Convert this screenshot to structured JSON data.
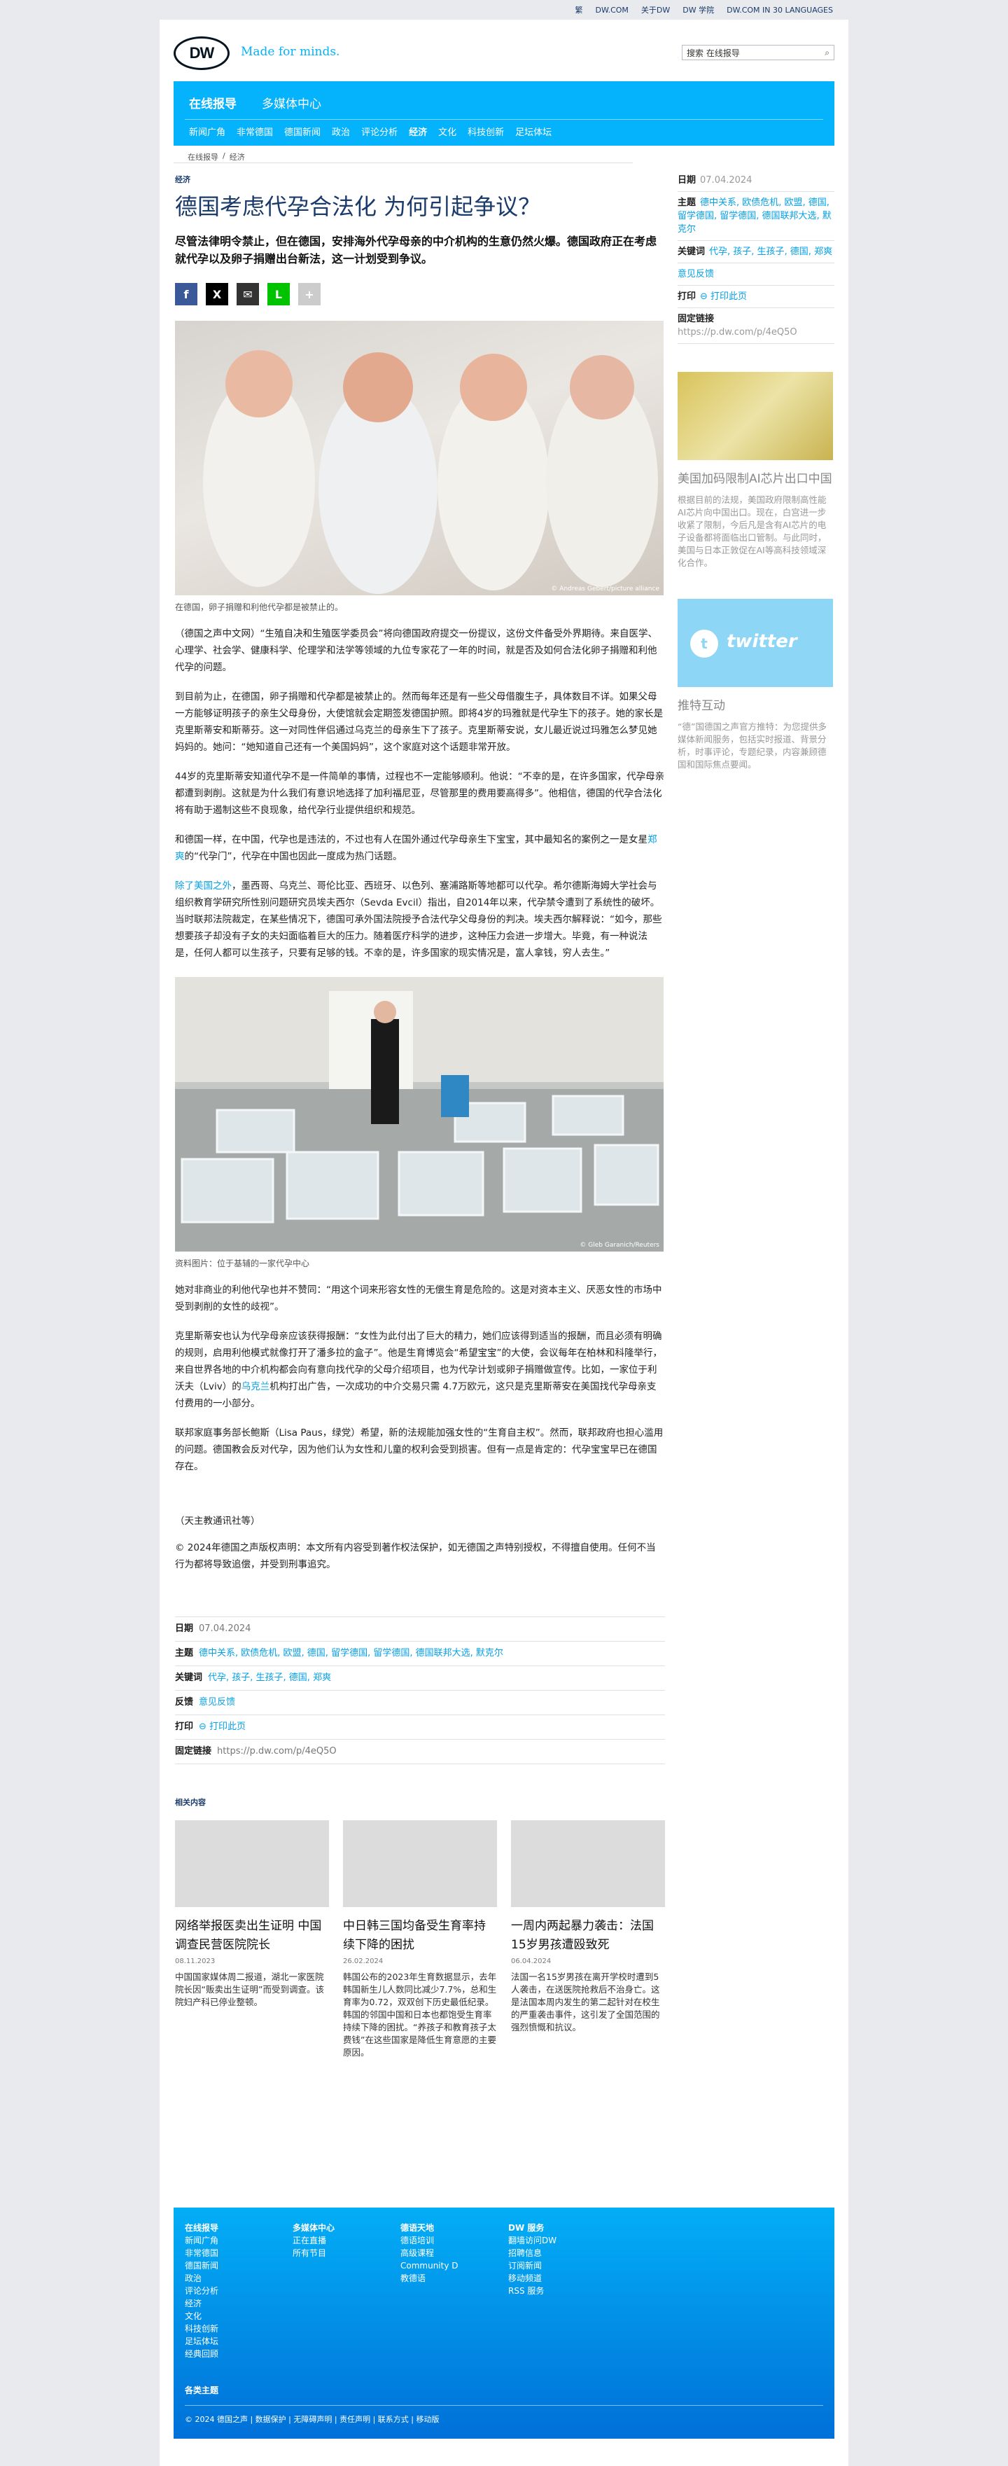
{
  "topbar": [
    "繁",
    "DW.COM",
    "关于DW",
    "DW 学院",
    "DW.COM IN 30 LANGUAGES"
  ],
  "header": {
    "logo": "DW",
    "tagline": "Made for minds.",
    "search_value": "搜索 在线报导",
    "search_icon": "search-icon"
  },
  "nav": {
    "title": "在线报导",
    "title2": "多媒体中心",
    "items": [
      "新闻广角",
      "非常德国",
      "德国新闻",
      "政治",
      "评论分析",
      "经济",
      "文化",
      "科技创新",
      "足坛体坛"
    ],
    "active_index": 5
  },
  "breadcrumb": [
    "在线报导",
    "/",
    "经济"
  ],
  "article": {
    "kicker": "经济",
    "title": "德国考虑代孕合法化 为何引起争议？",
    "lead": "尽管法律明令禁止，但在德国，安排海外代孕母亲的中介机构的生意仍然火爆。德国政府正在考虑就代孕以及卵子捐赠出台新法，这一计划受到争议。",
    "share": [
      {
        "icon": "facebook-icon",
        "glyph": "f",
        "color": "#3b5998"
      },
      {
        "icon": "x-icon",
        "glyph": "X",
        "color": "#000000"
      },
      {
        "icon": "email-icon",
        "glyph": "✉",
        "color": "#333333"
      },
      {
        "icon": "line-icon",
        "glyph": "L",
        "color": "#00c300"
      },
      {
        "icon": "more-icon",
        "glyph": "+",
        "color": "#cccccc"
      }
    ],
    "image1_credit": "© Andreas Gebert/picture alliance",
    "image1_caption": "在德国，卵子捐赠和利他代孕都是被禁止的。",
    "p1": "（德国之声中文网）“生殖自决和生殖医学委员会”将向德国政府提交一份提议，这份文件备受外界期待。来自医学、心理学、社会学、健康科学、伦理学和法学等领域的九位专家花了一年的时间，就是否及如何合法化卵子捐赠和利他代孕的问题。",
    "p2": "到目前为止，在德国，卵子捐赠和代孕都是被禁止的。然而每年还是有一些父母借腹生子，具体数目不详。如果父母一方能够证明孩子的亲生父母身份，大使馆就会定期签发德国护照。即将4岁的玛雅就是代孕生下的孩子。她的家长是克里斯蒂安和斯蒂芬。这一对同性伴侣通过乌克兰的母亲生下了孩子。克里斯蒂安说，女儿最近说过玛雅怎么梦见她妈妈的。她问：“她知道自己还有一个美国妈妈”，这个家庭对这个话题非常开放。",
    "p3": "44岁的克里斯蒂安知道代孕不是一件简单的事情，过程也不一定能够顺利。他说：“不幸的是，在许多国家，代孕母亲都遭到剥削。这就是为什么我们有意识地选择了加利福尼亚，尽管那里的费用要高得多”。他相信，德国的代孕合法化将有助于遏制这些不良现象，给代孕行业提供组织和规范。",
    "p4_pre": "和德国一样，在中国，代孕也是违法的，不过也有人在国外通过代孕母亲生下宝宝，其中最知名的案例之一是女星",
    "p4_link": "郑爽",
    "p4_post": "的“代孕门”，代孕在中国也因此一度成为热门话题。",
    "p5_link": "除了美国之外",
    "p5_pre2": "，墨西哥、乌克兰、哥伦比亚、西班牙、以色列、塞浦路斯等地都可以代孕。希尔德斯海姆大学社会与组织教育学研究所性别问题研究员埃夫西尔（Sevda Evcil）指出，自2014年以来，代孕禁令遭到了系统性的破坏。当时联邦法院裁定，在某些情况下，德国可承外国法院授予合法代孕父母身份的判决。埃夫西尔解释说：“如今，那些想要孩子却没有子女的夫妇面临着巨大的压力。随着医疗科学的进步，这种压力会进一步增大。毕竟，有一种说法是，任何人都可以生孩子，只要有足够的钱。不幸的是，许多国家的现实情况是，富人拿钱，穷人去生。”",
    "image2_credit": "© Gleb Garanich/Reuters",
    "image2_caption": "资料图片：位于基辅的一家代孕中心",
    "p6": "她对非商业的利他代孕也并不赞同：“用这个词来形容女性的无偿生育是危险的。这是对资本主义、厌恶女性的市场中受到剥削的女性的歧视”。",
    "p7_pre": "克里斯蒂安也认为代孕母亲应该获得报酬：“女性为此付出了巨大的精力，她们应该得到适当的报酬，而且必须有明确的规则，启用利他模式就像打开了潘多拉的盒子”。他是生育博览会“希望宝宝”的大使，会议每年在柏林和科隆举行，来自世界各地的中介机构都会向有意向找代孕的父母介绍项目，也为代孕计划或卵子捐赠做宣传。比如，一家位于利沃夫（Lviv）的",
    "p7_link": "乌克兰",
    "p7_post": "机构打出广告，一次成功的中介交易只需 4.7万欧元，这只是克里斯蒂安在美国找代孕母亲支付费用的一小部分。",
    "p8": "联邦家庭事务部长鲍斯（Lisa Paus，绿党）希望，新的法规能加强女性的“生育自主权”。然而，联邦政府也担心滥用的问题。德国教会反对代孕，因为他们认为女性和儿童的权利会受到损害。但有一点是肯定的：代孕宝宝早已在德国存在。",
    "source": "（天主教通讯社等）",
    "copyright": "© 2024年德国之声版权声明：本文所有内容受到著作权法保护，如无德国之声特别授权，不得擅自使用。任何不当行为都将导致追偿，并受到刑事追究。"
  },
  "meta": {
    "date_label": "日期",
    "date_value": "07.04.2024",
    "topics_label": "主题",
    "topics_value": "德中关系, 欧债危机, 欧盟, 德国, 留学德国, 留学德国, 德国联邦大选, 默克尔",
    "keywords_label": "关键词",
    "keywords_value": "代孕, 孩子, 生孩子, 德国, 郑爽",
    "feedback_label": "反馈",
    "feedback_value": "意见反馈",
    "print_label": "打印",
    "print_value": "⊖ 打印此页",
    "link_label": "固定链接",
    "link_value": "https://p.dw.com/p/4eQ5O"
  },
  "side": {
    "date_label": "日期",
    "date_value": "07.04.2024",
    "topics_label": "主题",
    "topics_value": "德中关系, 欧债危机, 欧盟, 德国, 留学德国, 留学德国, 德国联邦大选, 默克尔",
    "keywords_label": "关键词",
    "keywords_value": "代孕, 孩子, 生孩子, 德国, 郑爽",
    "feedback_value": "意见反馈",
    "print_label": "打印",
    "print_value": "⊖ 打印此页",
    "link_label": "固定链接",
    "link_value": "https://p.dw.com/p/4eQ5O",
    "card1_title": "美国加码限制AI芯片出口中国",
    "card1_text": "根据目前的法规，美国政府限制高性能AI芯片向中国出口。现在，白宫进一步收紧了限制，今后凡是含有AI芯片的电子设备都将面临出口管制。与此同时，美国与日本正敦促在AI等高科技领域深化合作。",
    "card2_title": "推特互动",
    "card2_text": "“德”国德国之声官方推特：为您提供多媒体新闻服务，包括实时报道、背景分析，时事评论，专题纪录，内容兼顾德国和国际焦点要闻。",
    "twitter_word": "twitter"
  },
  "related": {
    "heading": "相关内容",
    "items": [
      {
        "title": "网络举报医卖出生证明 中国调查民营医院院长",
        "date": "08.11.2023",
        "text": "中国国家媒体周二报道，湖北一家医院院长因“贩卖出生证明”而受到调查。该院妇产科已停业整顿。"
      },
      {
        "title": "中日韩三国均备受生育率持续下降的困扰",
        "date": "26.02.2024",
        "text": "韩国公布的2023年生育数据显示，去年韩国新生儿人数同比减少7.7%，总和生育率为0.72，双双创下历史最低纪录。韩国的邻国中国和日本也都饱受生育率持续下降的困扰。“养孩子和教育孩子太费钱”在这些国家是降低生育意愿的主要原因。"
      },
      {
        "title": "一周内两起暴力袭击：法国15岁男孩遭殴致死",
        "date": "06.04.2024",
        "text": "法国一名15岁男孩在离开学校时遭到5人袭击，在送医院抢救后不治身亡。这是法国本周内发生的第二起针对在校生的严重袭击事件，这引发了全国范围的强烈愤慨和抗议。"
      }
    ]
  },
  "footer": {
    "col1": [
      "在线报导",
      "新闻广角",
      "非常德国",
      "德国新闻",
      "政治",
      "评论分析",
      "经济",
      "文化",
      "科技创新",
      "足坛体坛",
      "经典回顾"
    ],
    "col2": [
      "多媒体中心",
      "正在直播",
      "所有节目"
    ],
    "col3": [
      "德语天地",
      "德语培训",
      "高级课程",
      "Community D",
      "教德语"
    ],
    "col4": [
      "DW 服务",
      "翻墙访问DW",
      "招聘信息",
      "订阅新闻",
      "移动频道",
      "RSS 服务"
    ],
    "topics": "各类主题",
    "copyright": "© 2024 德国之声 | 数据保护 | 无障碍声明 | 责任声明 | 联系方式 | 移动版"
  }
}
